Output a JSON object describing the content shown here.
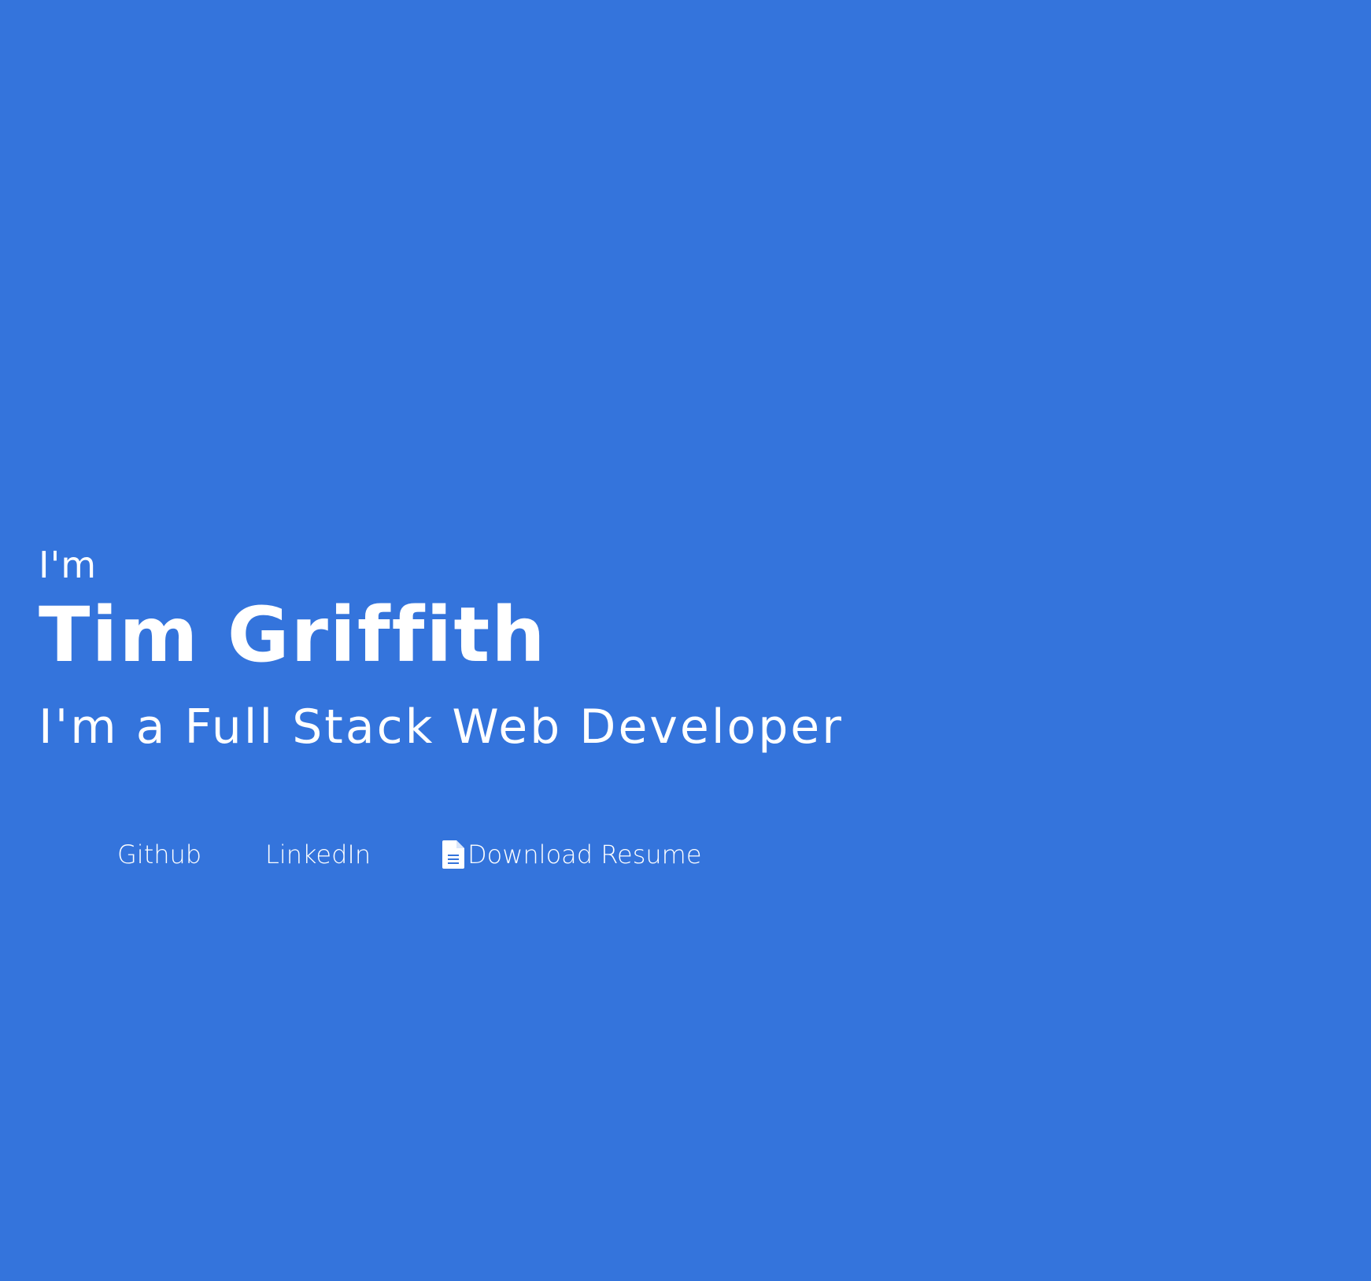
{
  "hero": {
    "intro": "I'm",
    "name": "Tim Griffith",
    "role": "I'm a Full Stack Web Developer"
  },
  "links": {
    "github": "Github",
    "linkedin": "LinkedIn",
    "resume": "Download Resume",
    "resume_icon": "document-icon"
  },
  "colors": {
    "background": "#3474dc",
    "text": "#ffffff"
  }
}
